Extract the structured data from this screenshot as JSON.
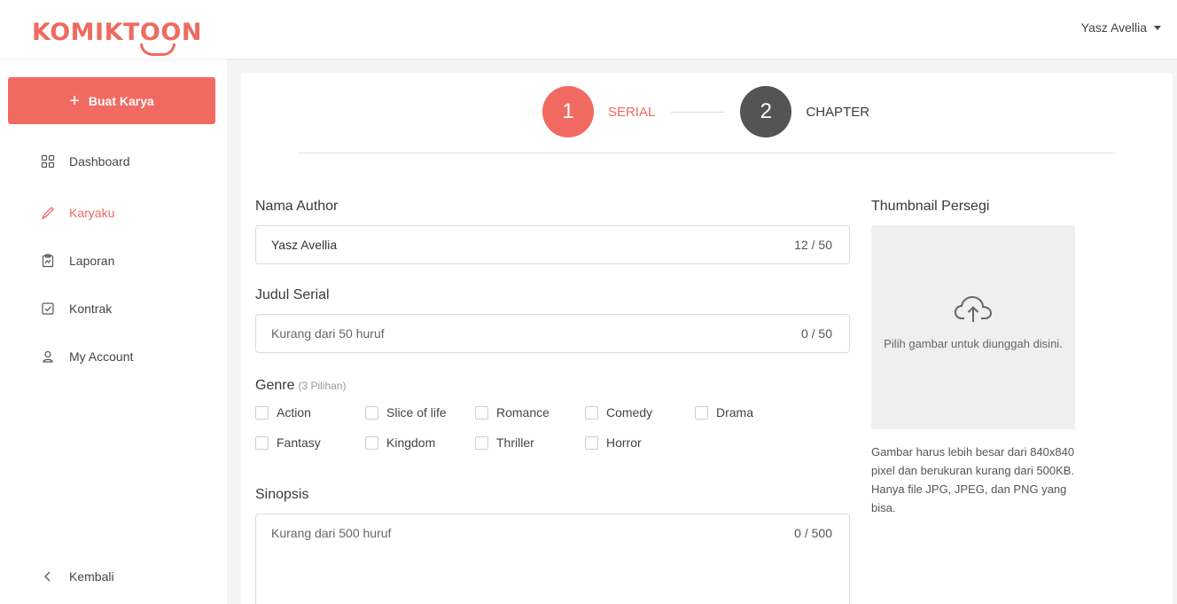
{
  "brand": {
    "name": "KOMIKTOON",
    "color": "#ef6a60"
  },
  "user": {
    "name": "Yasz Avellia"
  },
  "sidebar": {
    "create_button": "Buat Karya",
    "items": [
      {
        "label": "Dashboard",
        "icon": "grid-icon",
        "active": false
      },
      {
        "label": "Karyaku",
        "icon": "pen-icon",
        "active": true
      },
      {
        "label": "Laporan",
        "icon": "report-icon",
        "active": false
      },
      {
        "label": "Kontrak",
        "icon": "checkbox-icon",
        "active": false
      },
      {
        "label": "My Account",
        "icon": "user-icon",
        "active": false
      }
    ],
    "back_label": "Kembali"
  },
  "stepper": {
    "steps": [
      {
        "number": "1",
        "label": "SERIAL",
        "active": true
      },
      {
        "number": "2",
        "label": "CHAPTER",
        "active": false
      }
    ]
  },
  "form": {
    "author": {
      "label": "Nama Author",
      "value": "Yasz Avellia",
      "count": "12",
      "max": "50"
    },
    "title": {
      "label": "Judul Serial",
      "placeholder": "Kurang dari 50 huruf",
      "count": "0",
      "max": "50"
    },
    "genre": {
      "label": "Genre",
      "hint": "(3 Pilihan)",
      "options": [
        "Action",
        "Slice of life",
        "Romance",
        "Comedy",
        "Drama",
        "Fantasy",
        "Kingdom",
        "Thriller",
        "Horror"
      ]
    },
    "synopsis": {
      "label": "Sinopsis",
      "placeholder": "Kurang dari 500 huruf",
      "count": "0",
      "max": "500"
    }
  },
  "thumbnail": {
    "label": "Thumbnail Persegi",
    "upload_text": "Pilih gambar untuk diunggah disini.",
    "note": "Gambar harus lebih besar dari 840x840 pixel dan berukuran kurang dari 500KB. Hanya file JPG, JPEG, dan PNG yang bisa."
  }
}
